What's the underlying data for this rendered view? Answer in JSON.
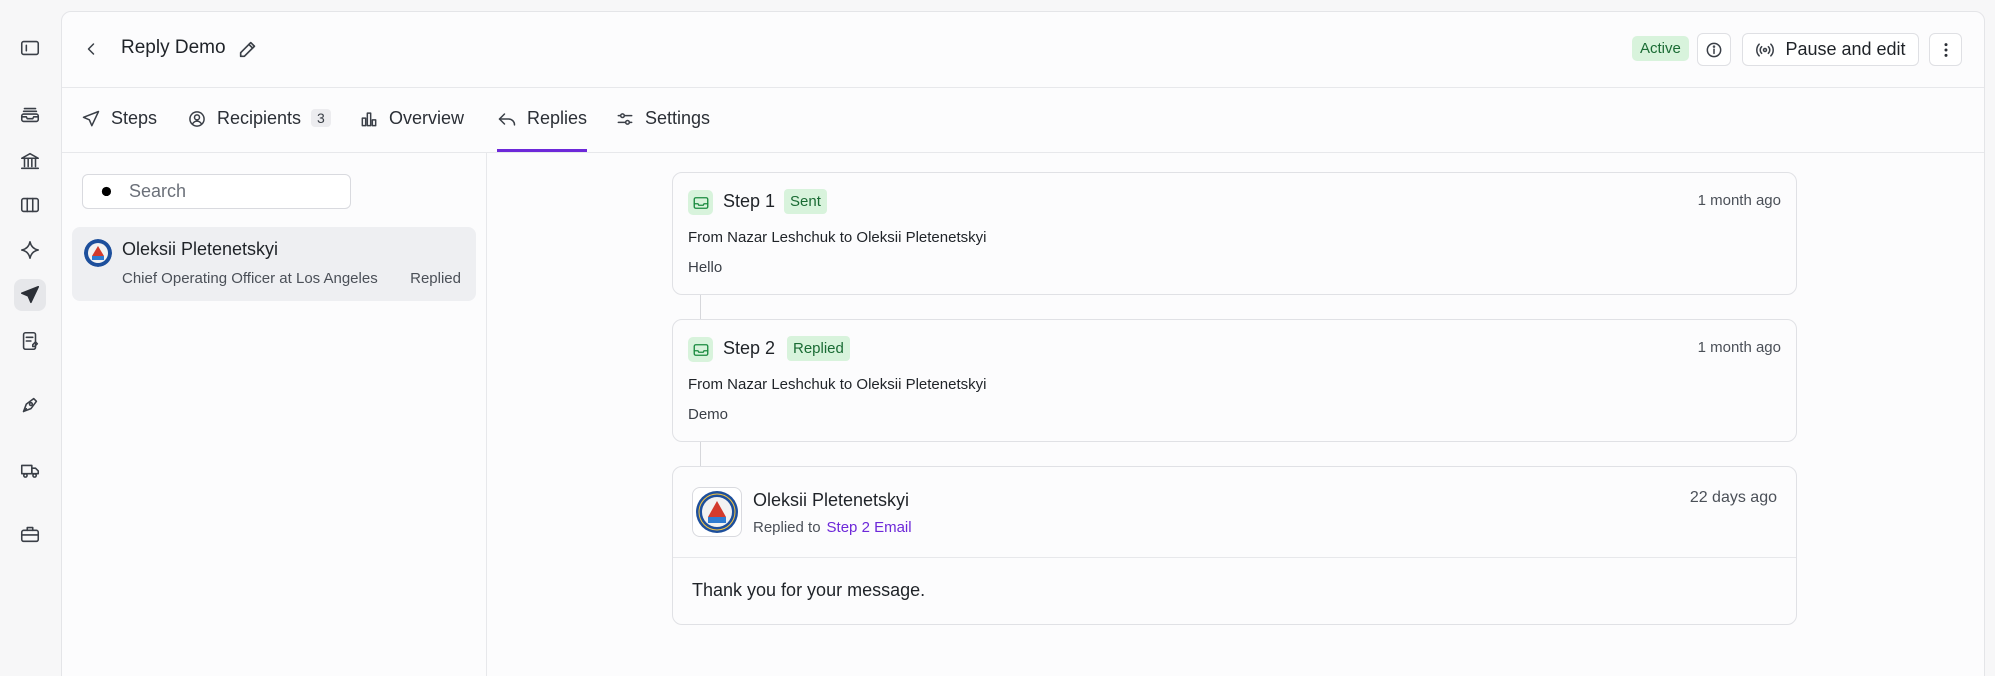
{
  "rail": {
    "items": [
      {
        "icon": "sidebar-toggle-icon"
      },
      {
        "icon": "inbox-stack-icon"
      },
      {
        "icon": "bank-icon"
      },
      {
        "icon": "columns-icon"
      },
      {
        "icon": "sparkle-icon"
      },
      {
        "icon": "send-icon",
        "active": true
      },
      {
        "icon": "notes-icon"
      },
      {
        "icon": "rocket-icon"
      },
      {
        "icon": "truck-icon"
      },
      {
        "icon": "briefcase-icon"
      }
    ]
  },
  "header": {
    "title": "Reply Demo",
    "status": "Active",
    "pause_label": "Pause and edit"
  },
  "tabs": [
    {
      "label": "Steps",
      "icon": "send-icon"
    },
    {
      "label": "Recipients",
      "icon": "user-circle-icon",
      "count": "3"
    },
    {
      "label": "Overview",
      "icon": "bar-chart-icon"
    },
    {
      "label": "Replies",
      "icon": "reply-icon",
      "active": true
    },
    {
      "label": "Settings",
      "icon": "sliders-icon"
    }
  ],
  "list": {
    "search_placeholder": "Search",
    "items": [
      {
        "name": "Oleksii Pletenetskyi",
        "subtitle": "Chief Operating Officer at Los Angeles",
        "status": "Replied"
      }
    ]
  },
  "steps": [
    {
      "title": "Step 1",
      "badge": "Sent",
      "time": "1 month ago",
      "from": "From Nazar Leshchuk to Oleksii Pletenetskyi",
      "body": "Hello"
    },
    {
      "title": "Step 2",
      "badge": "Replied",
      "time": "1 month ago",
      "from": "From Nazar Leshchuk to Oleksii Pletenetskyi",
      "body": "Demo"
    }
  ],
  "reply": {
    "name": "Oleksii Pletenetskyi",
    "meta_prefix": "Replied to",
    "meta_link": "Step 2 Email",
    "time": "22 days ago",
    "body": "Thank you for your message."
  },
  "colors": {
    "accent": "#6d28d9",
    "success_bg": "#d8f3dc",
    "success_text": "#1a6b34"
  }
}
